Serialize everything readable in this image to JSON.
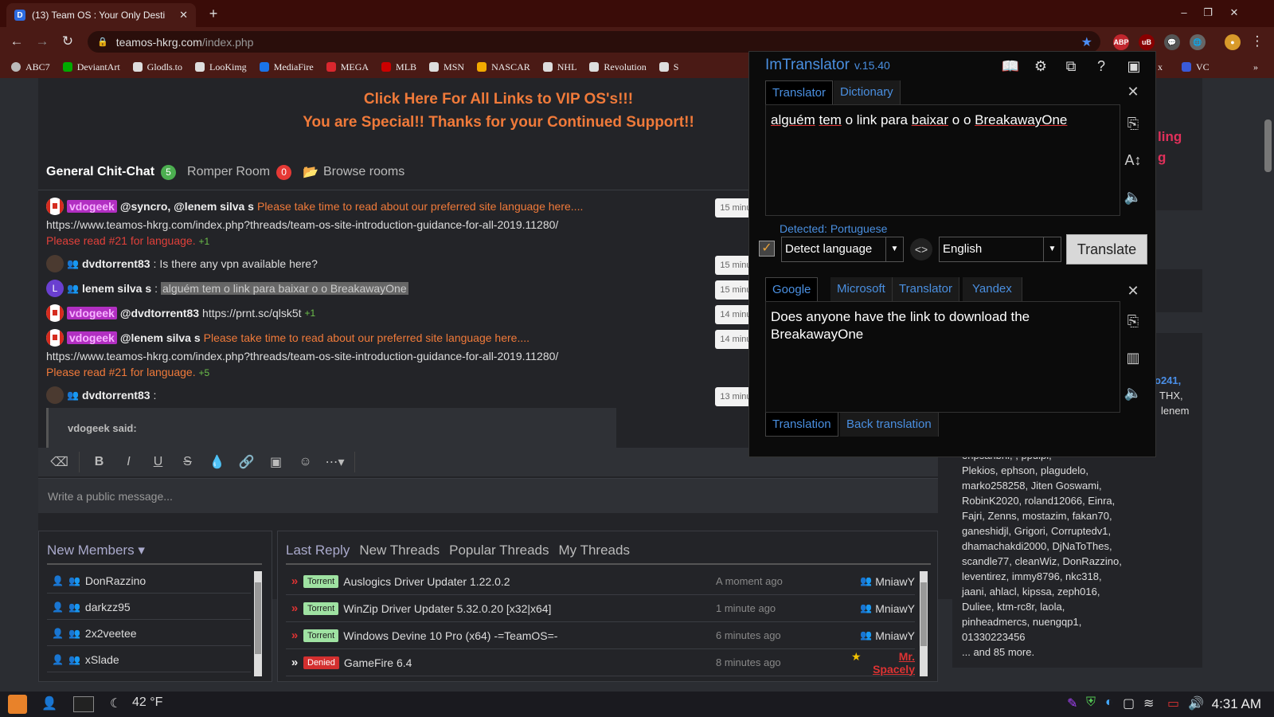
{
  "browser": {
    "tab_title": "(13) Team OS : Your Only Desti",
    "tab_close": "✕",
    "new_tab": "+",
    "url_host": "teamos-hkrg.com",
    "url_path": "/index.php",
    "window_controls": [
      "–",
      "❐",
      "✕"
    ],
    "bookmarks": [
      {
        "label": "ABC7",
        "color": "#bbb"
      },
      {
        "label": "DeviantArt",
        "color": "#0a0"
      },
      {
        "label": "Glodls.to",
        "color": "#ddd"
      },
      {
        "label": "LooKimg",
        "color": "#ddd"
      },
      {
        "label": "MediaFire",
        "color": "#1a73e8"
      },
      {
        "label": "MEGA",
        "color": "#d9272e"
      },
      {
        "label": "MLB",
        "color": "#c00"
      },
      {
        "label": "MSN",
        "color": "#ddd"
      },
      {
        "label": "NASCAR",
        "color": "#f2a900"
      },
      {
        "label": "NHL",
        "color": "#ddd"
      },
      {
        "label": "Revolution",
        "color": "#ddd"
      },
      {
        "label": "S",
        "color": "#ddd"
      }
    ],
    "bookmarks_tail": [
      "x",
      "VC",
      "»"
    ]
  },
  "banner": {
    "line1": "Click Here For All Links to VIP OS's!!!",
    "line2": "You are Special!! Thanks for your Continued Support!!"
  },
  "chat": {
    "tabs": [
      {
        "label": "General Chit-Chat",
        "count": "5",
        "color": "#4caf50"
      },
      {
        "label": "Romper Room",
        "count": "0",
        "color": "#e53935"
      }
    ],
    "browse": "Browse rooms",
    "messages": {
      "m1": {
        "user": "vdogeek",
        "mentions": "@syncro, @lenem silva s",
        "text": "Please take time to read about our preferred site language here....",
        "time": "15 minutes ago"
      },
      "m1_link": "https://www.teamos-hkrg.com/index.php?threads/team-os-site-introduction-guidance-for-all-2019.11280/",
      "m1_note": "Please read #21 for language.",
      "m1_plus": "+1",
      "m2": {
        "user": "dvdtorrent83",
        "text": "Is there any vpn available here?",
        "time": "15 minutes ago"
      },
      "m3": {
        "avatar": "L",
        "user": "lenem silva s",
        "text": "alguém tem o link para baixar o o BreakawayOne",
        "time": "15 minutes ago"
      },
      "m4": {
        "user": "vdogeek",
        "mentions": "@dvdtorrent83",
        "text": "https://prnt.sc/qlsk5t",
        "plus": "+1",
        "time": "14 minutes ago"
      },
      "m5": {
        "user": "vdogeek",
        "mentions": "@lenem silva s",
        "text": "Please take time to read about our preferred site language here....",
        "time": "14 minutes ago"
      },
      "m5_link": "https://www.teamos-hkrg.com/index.php?threads/team-os-site-introduction-guidance-for-all-2019.11280/",
      "m5_note": "Please read #21 for language.",
      "m5_plus": "+5",
      "m6": {
        "user": "dvdtorrent83",
        "time": "13 minutes ago"
      },
      "quote": "vdogeek said:"
    },
    "input_placeholder": "Write a public message..."
  },
  "members": {
    "title": "New Members",
    "list": [
      "DonRazzino",
      "darkzz95",
      "2x2veetee",
      "xSlade"
    ]
  },
  "threads": {
    "tabs": [
      "Last Reply",
      "New Threads",
      "Popular Threads",
      "My Threads"
    ],
    "rows": [
      {
        "tag": "Torrent",
        "title": "Auslogics Driver Updater 1.22.0.2",
        "time": "A moment ago",
        "by": "MniawY"
      },
      {
        "tag": "Torrent",
        "title": "WinZip Driver Updater 5.32.0.20 [x32|x64]",
        "time": "1 minute ago",
        "by": "MniawY"
      },
      {
        "tag": "Torrent",
        "title": "Windows Devine 10 Pro (x64) -=TeamOS=-",
        "time": "6 minutes ago",
        "by": "MniawY"
      },
      {
        "tag": "Denied",
        "title": "GameFire 6.4",
        "time": "8 minutes ago",
        "by": "Mr. Spacely"
      }
    ]
  },
  "sidebar": {
    "pink1": "ling",
    "pink2": "g",
    "frag_user": "o241,",
    "frag2": "THX,",
    "frag3": "lenem",
    "online_lines": [
      "ehpsahbhi, , ppuipi,",
      "Plekios, ephson, plagudelo,",
      "marko258258, Jiten Goswami,",
      "RobinK2020, roland12066, Einra,",
      "Fajri, Zenns, mostazim, fakan70,",
      "ganeshidjl, Grigori, Corruptedv1,",
      "dhamachakdi2000, DjNaToThes,",
      "scandle77, cleanWiz, DonRazzino,",
      "leventirez, immy8796, nkc318,",
      "jaani, ahlacl, kipssa, zeph016,",
      "Duliee, ktm-rc8r, laola,",
      "pinheadmercs, nuengqp1,",
      "01330223456",
      "... and 85 more."
    ]
  },
  "translator": {
    "title": "ImTranslator",
    "version": "v.15.40",
    "top_tabs": [
      "Translator",
      "Dictionary"
    ],
    "source_words": [
      "alguém",
      " ",
      "tem",
      " o link para ",
      "baixar",
      " o o ",
      "BreakawayOne"
    ],
    "detected": "Detected: Portuguese",
    "from": "Detect language",
    "to": "English",
    "translate_btn": "Translate",
    "engines": [
      "Google",
      "Microsoft",
      "Translator",
      "Yandex"
    ],
    "result": "Does anyone have the link to download the BreakawayOne",
    "bottom_tabs": [
      "Translation",
      "Back translation"
    ]
  },
  "taskbar": {
    "weather": "42 °F",
    "clock": "4:31 AM"
  }
}
